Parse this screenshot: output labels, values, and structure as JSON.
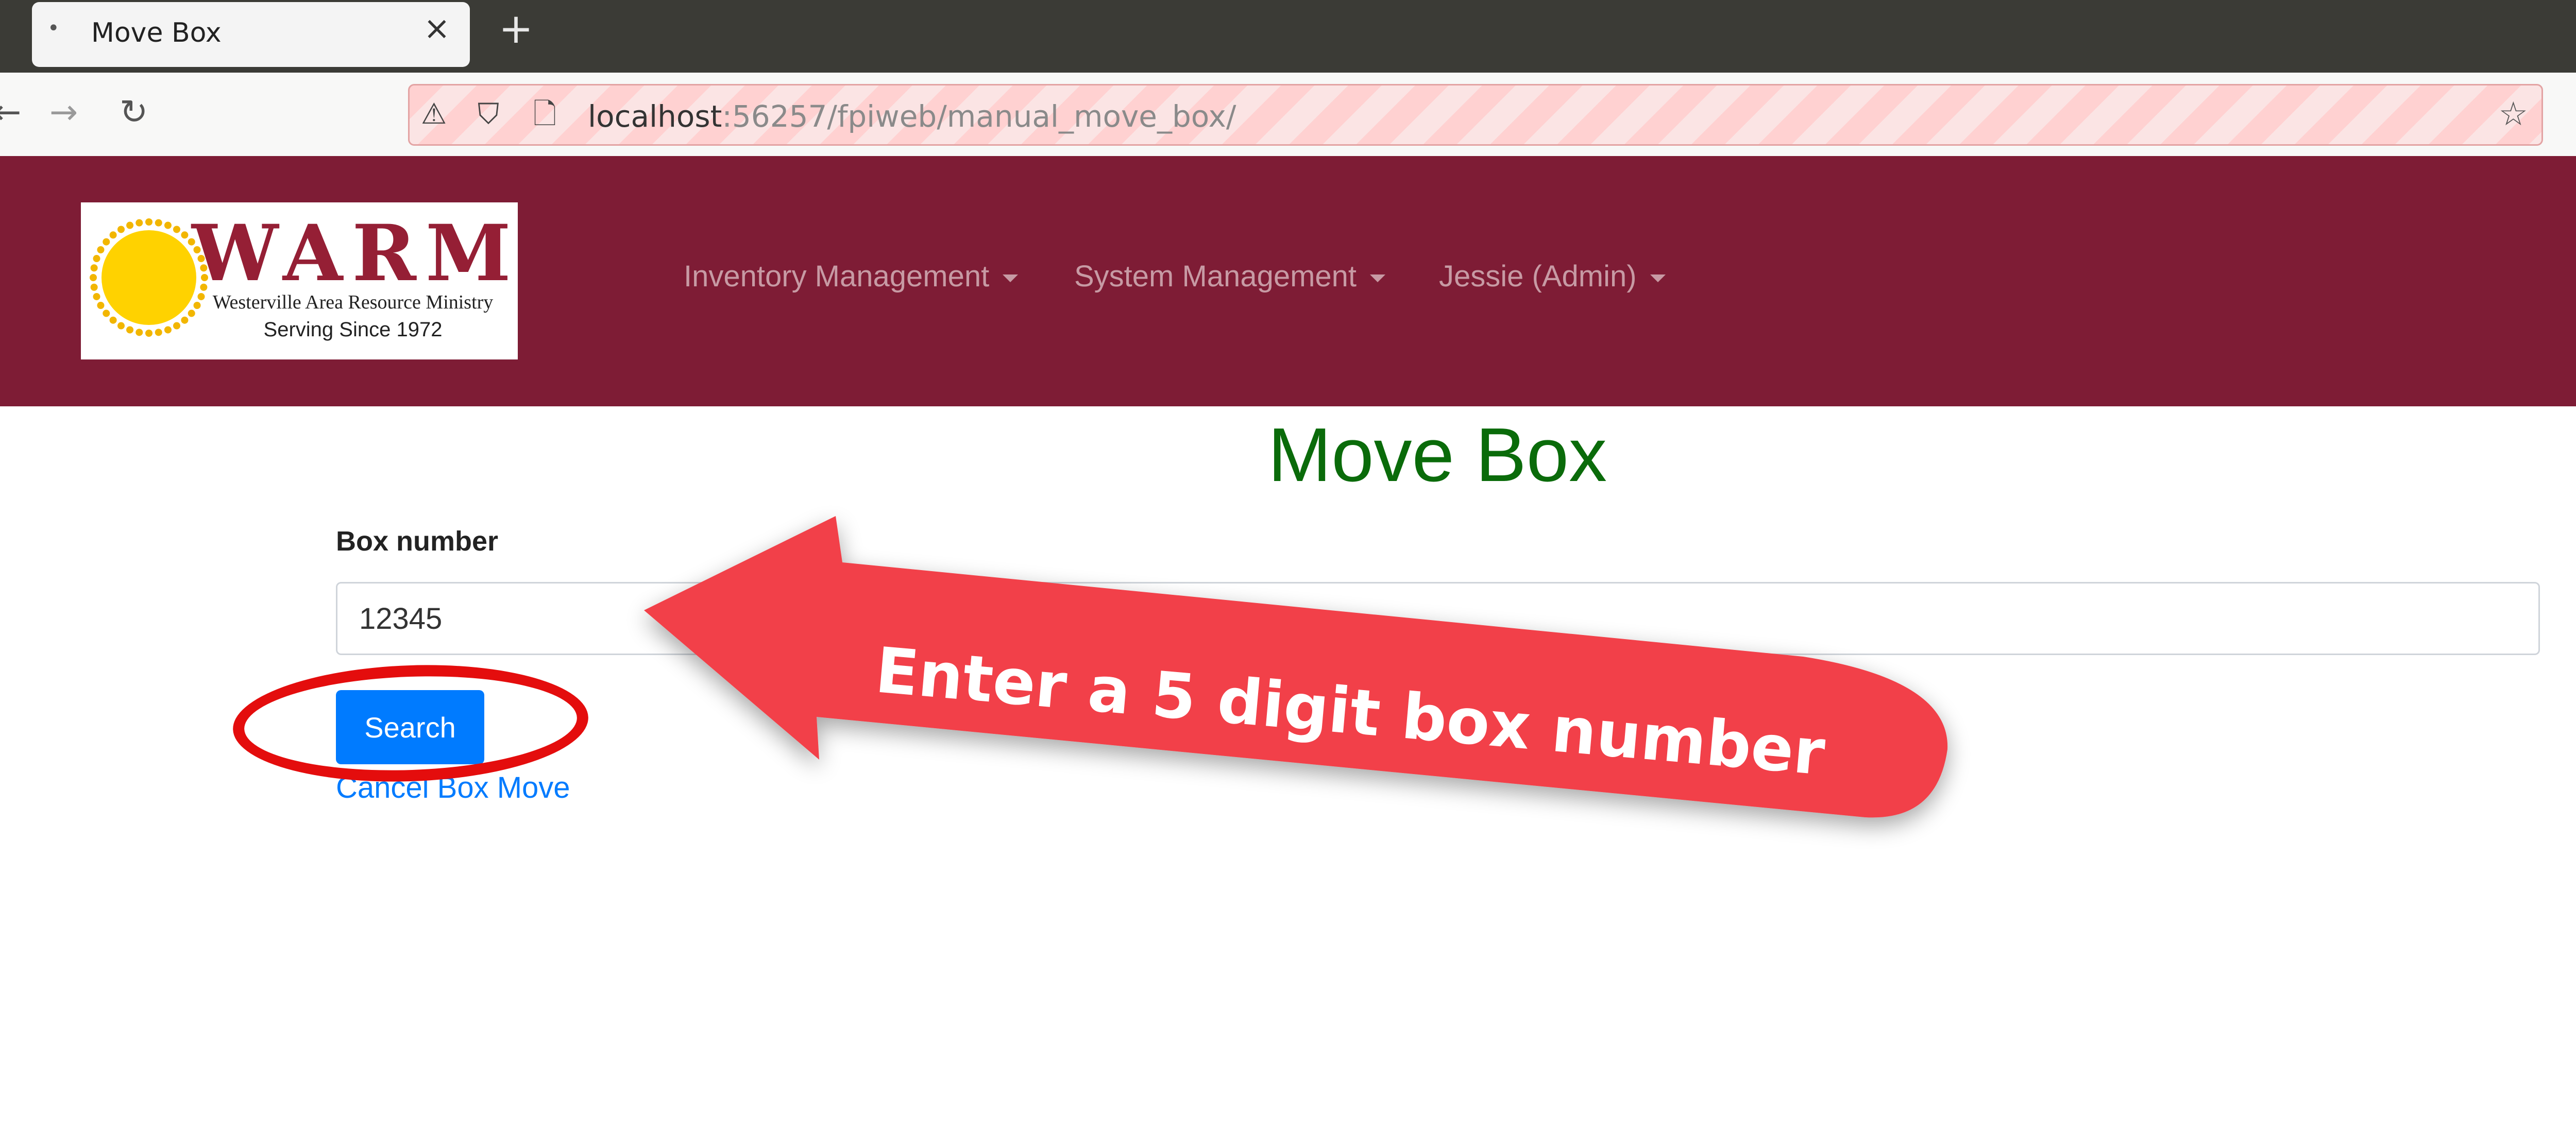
{
  "browser": {
    "tab_title": "Move Box",
    "tab_close": "×",
    "new_tab": "+",
    "url_host": "localhost",
    "url_rest": ":56257/fpiweb/manual_move_box/",
    "icons": [
      "back-arrow-icon",
      "forward-arrow-icon",
      "reload-icon",
      "camera-warning-icon",
      "shield-icon",
      "page-icon",
      "bookmark-star-icon"
    ]
  },
  "header": {
    "background": "#7e1c35",
    "logo": {
      "word": "WARM",
      "subtitle": "Westerville Area Resource Ministry",
      "since": "Serving Since 1972"
    },
    "menu": [
      {
        "label": "Inventory Management"
      },
      {
        "label": "System Management"
      },
      {
        "label": "Jessie (Admin)"
      }
    ]
  },
  "main": {
    "title": "Move Box",
    "title_color": "#0a6b0a",
    "box_number_label": "Box number",
    "box_number_value": "12345",
    "search_button": "Search",
    "cancel_link": "Cancel Box Move",
    "accent": "#007bff"
  },
  "annotation": {
    "callout_text": "Enter a 5 digit box number",
    "callout_color": "#f24148",
    "ring_color": "#e40d0d"
  }
}
